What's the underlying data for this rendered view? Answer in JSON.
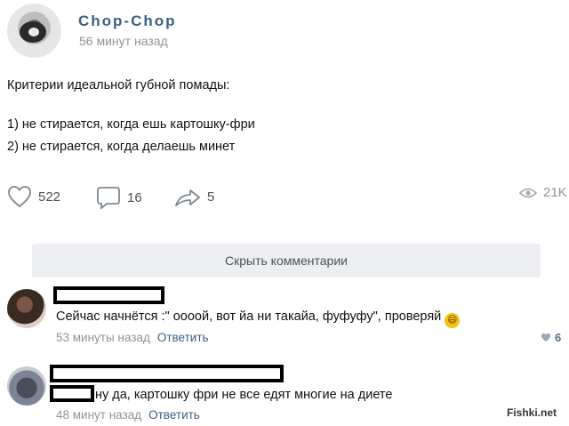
{
  "post": {
    "author": "Chop-Chop",
    "time": "56 минут назад",
    "text": [
      "Критерии идеальной губной помады:",
      "1) не стирается, когда ешь картошку-фри",
      "2) не стирается, когда делаешь минет"
    ],
    "likes": "522",
    "comments": "16",
    "shares": "5",
    "views": "21K"
  },
  "hide_comments_label": "Скрыть комментарии",
  "comments": [
    {
      "text": "Сейчас начнётся :\" оооой, вот йа ни такайа, фуфуфу\", проверяй",
      "emoji": "😄",
      "time": "53 минуты назад",
      "reply_label": "Ответить",
      "likes": "6"
    },
    {
      "text": "ну да, картошку фри не все едят многие на диете",
      "time": "48 минут назад",
      "reply_label": "Ответить"
    }
  ],
  "watermark": "Fishki.net",
  "colors": {
    "link": "#3b5e84",
    "meta": "#8f9399",
    "button_bg": "#eceef1"
  }
}
